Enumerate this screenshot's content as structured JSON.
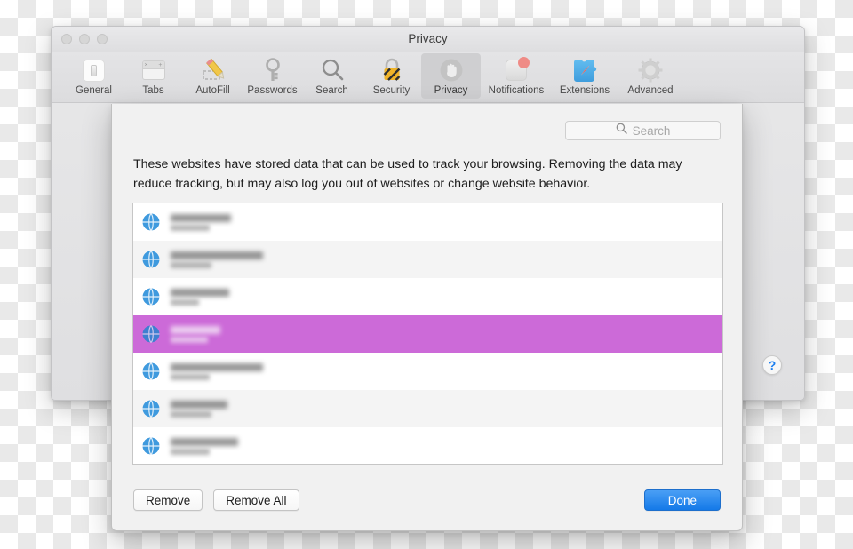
{
  "window": {
    "title": "Privacy",
    "traffic_lights": [
      "close-button",
      "minimize-button",
      "zoom-button"
    ]
  },
  "toolbar": {
    "items": [
      {
        "label": "General",
        "icon": "general-icon",
        "selected": false
      },
      {
        "label": "Tabs",
        "icon": "tabs-icon",
        "selected": false
      },
      {
        "label": "AutoFill",
        "icon": "autofill-icon",
        "selected": false
      },
      {
        "label": "Passwords",
        "icon": "key-icon",
        "selected": false
      },
      {
        "label": "Search",
        "icon": "magnifier-icon",
        "selected": false
      },
      {
        "label": "Security",
        "icon": "lock-icon",
        "selected": false
      },
      {
        "label": "Privacy",
        "icon": "hand-icon",
        "selected": true
      },
      {
        "label": "Notifications",
        "icon": "notifications-icon",
        "selected": false
      },
      {
        "label": "Extensions",
        "icon": "puzzle-icon",
        "selected": false
      },
      {
        "label": "Advanced",
        "icon": "gear-icon",
        "selected": false
      }
    ]
  },
  "sheet": {
    "search": {
      "icon": "search-icon",
      "placeholder": "Search",
      "value": ""
    },
    "description": "These websites have stored data that can be used to track your browsing. Removing the data may reduce tracking, but may also log you out of websites or change website behavior.",
    "list": {
      "rows": [
        {
          "icon": "globe-icon",
          "title_redacted": true,
          "title_width": 68,
          "detail_width": 44,
          "selected": false
        },
        {
          "icon": "globe-icon",
          "title_redacted": true,
          "title_width": 104,
          "detail_width": 46,
          "selected": false
        },
        {
          "icon": "globe-icon",
          "title_redacted": true,
          "title_width": 66,
          "detail_width": 32,
          "selected": false
        },
        {
          "icon": "globe-icon",
          "title_redacted": true,
          "title_width": 56,
          "detail_width": 42,
          "selected": true
        },
        {
          "icon": "globe-icon",
          "title_redacted": true,
          "title_width": 104,
          "detail_width": 44,
          "selected": false
        },
        {
          "icon": "globe-icon",
          "title_redacted": true,
          "title_width": 64,
          "detail_width": 46,
          "selected": false
        },
        {
          "icon": "globe-icon",
          "title_redacted": true,
          "title_width": 76,
          "detail_width": 44,
          "selected": false
        }
      ]
    },
    "buttons": {
      "remove": "Remove",
      "remove_all": "Remove All",
      "done": "Done"
    }
  },
  "help": {
    "label": "?",
    "icon": "help-icon"
  },
  "colors": {
    "selection": "#cc6ad8",
    "accent_button": "#1479e8",
    "help_glyph": "#1a7ef0",
    "notification_badge": "#ef8b86",
    "window_chrome": "#e4e4e6",
    "sheet_background": "#f1f1f1"
  }
}
